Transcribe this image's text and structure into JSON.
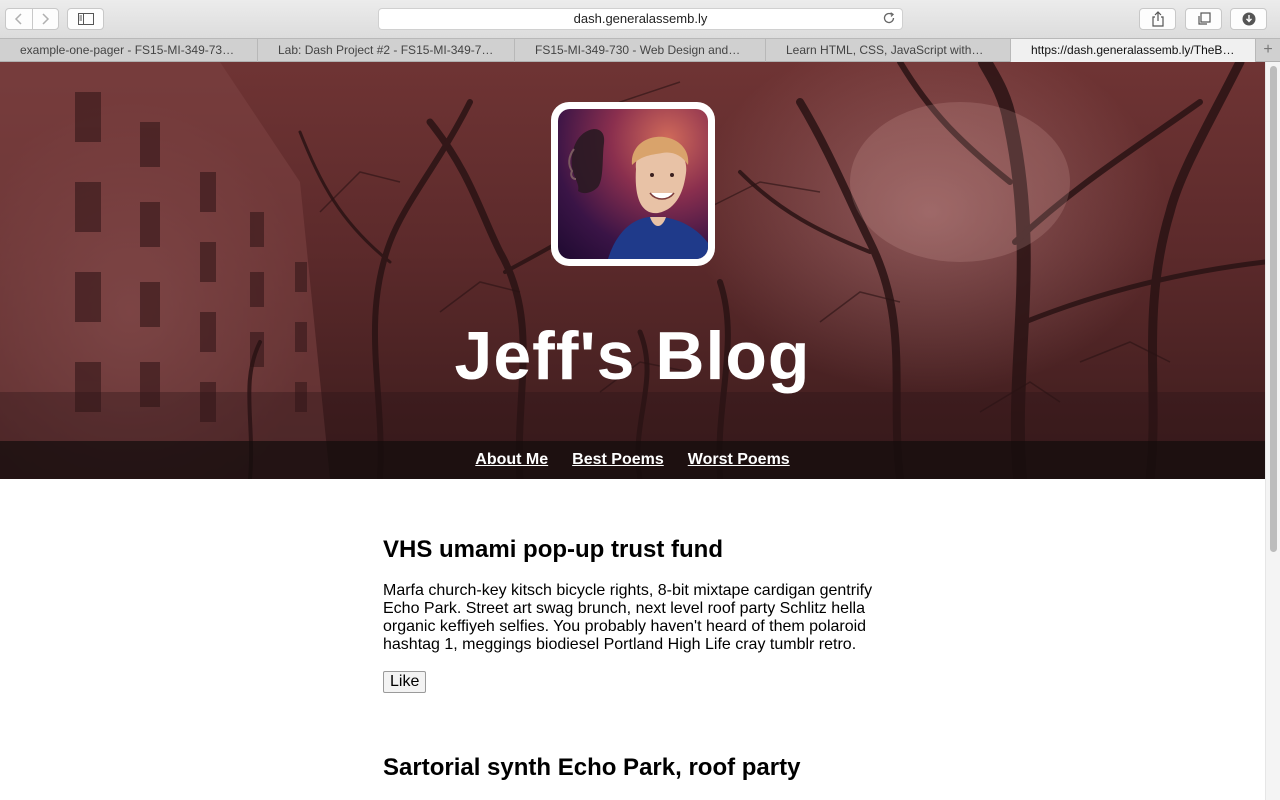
{
  "browser": {
    "url": "dash.generalassemb.ly",
    "tabs": [
      {
        "label": "example-one-pager - FS15-MI-349-73…",
        "active": false
      },
      {
        "label": "Lab: Dash Project #2 - FS15-MI-349-7…",
        "active": false
      },
      {
        "label": "FS15-MI-349-730 - Web Design and…",
        "active": false
      },
      {
        "label": "Learn HTML, CSS, JavaScript with…",
        "active": false
      },
      {
        "label": "https://dash.generalassemb.ly/TheB…",
        "active": true
      }
    ],
    "new_tab_label": "+"
  },
  "blog": {
    "title": "Jeff's Blog",
    "nav": [
      "About Me",
      "Best Poems",
      "Worst Poems"
    ]
  },
  "posts": [
    {
      "title": "VHS umami pop-up trust fund",
      "body": "Marfa church-key kitsch bicycle rights, 8-bit mixtape cardigan gentrify Echo Park. Street art swag brunch, next level roof party Schlitz hella organic keffiyeh selfies. You probably haven't heard of them polaroid hashtag 1, meggings biodiesel Portland High Life cray tumblr retro.",
      "like_label": "Like"
    },
    {
      "title": "Sartorial synth Echo Park, roof party"
    }
  ],
  "colors": {
    "hero_tint": "#5c2a2b",
    "nav_strip": "#140c0c",
    "link": "#ffffff"
  }
}
